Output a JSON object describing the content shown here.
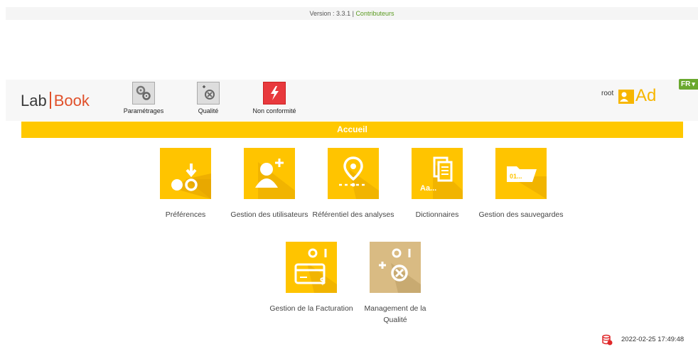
{
  "footer_top": {
    "version_label": "Version : 3.3.1 |",
    "contributors_link": "Contributeurs"
  },
  "header": {
    "logo_lab": "Lab",
    "logo_book": "Book",
    "nav": [
      {
        "label": "Paramétrages",
        "icon": "gears-icon"
      },
      {
        "label": "Qualité",
        "icon": "quality-icon"
      },
      {
        "label": "Non conformité",
        "icon": "lightning-icon"
      }
    ],
    "user_name": "root",
    "user_initials": "Ad",
    "lang": "FR",
    "accent_color": "#ffc800"
  },
  "title": "Accueil",
  "tiles": [
    {
      "label": "Préférences",
      "icon": "preferences-icon"
    },
    {
      "label": "Gestion des utilisateurs",
      "icon": "add-user-icon"
    },
    {
      "label": "Référentiel des analyses",
      "icon": "location-pin-icon"
    },
    {
      "label": "Dictionnaires",
      "icon": "documents-icon"
    },
    {
      "label": "Gestion des sauvegardes",
      "icon": "folder-icon"
    },
    {
      "label": "Gestion de la Facturation",
      "icon": "credit-card-icon"
    },
    {
      "label": "Management de la Qualité",
      "icon": "quality-management-icon"
    }
  ],
  "footer": {
    "timestamp": "2022-02-25 17:49:48"
  }
}
